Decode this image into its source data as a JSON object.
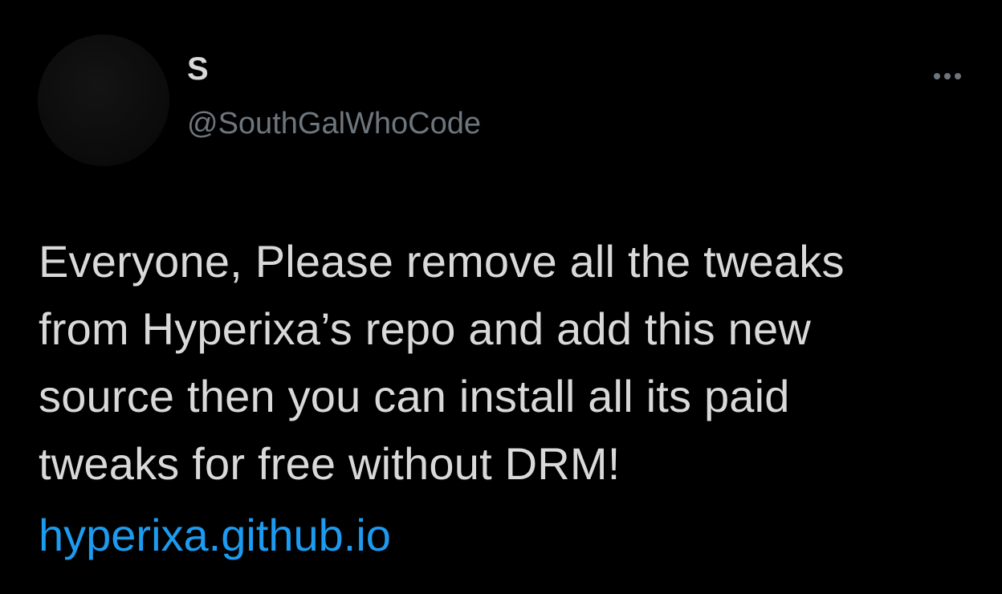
{
  "author": {
    "display_name": "S",
    "handle": "@SouthGalWhoCode"
  },
  "actions": {
    "more_icon": "more-horizontal-icon"
  },
  "tweet": {
    "lines": [
      "Everyone, Please remove all the tweaks",
      "from Hyperixa’s repo and add this new",
      "source then you can install all its paid",
      "tweaks for free without DRM!"
    ],
    "link": "hyperixa.github.io"
  },
  "colors": {
    "background": "#000000",
    "text": "#d9d9d9",
    "secondary_text": "#6e767d",
    "link": "#1d9bf0"
  }
}
